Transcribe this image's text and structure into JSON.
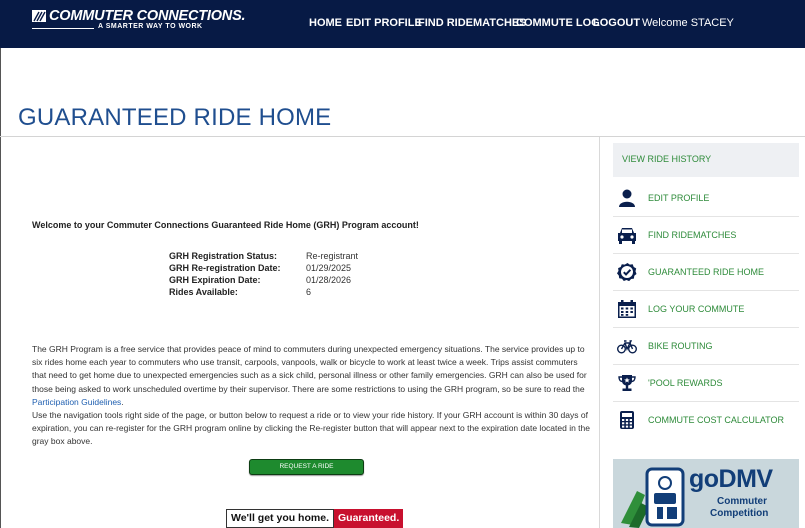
{
  "header": {
    "logo_title": "COMMUTER CONNECTIONS.",
    "logo_tagline": "A SMARTER WAY TO WORK",
    "nav": [
      "HOME",
      "EDIT PROFILE",
      "FIND RIDEMATCHES",
      "COMMUTE LOG",
      "LOGOUT"
    ],
    "welcome": "Welcome STACEY"
  },
  "page": {
    "title": "GUARANTEED RIDE HOME"
  },
  "main": {
    "welcome_line": "Welcome to your Commuter Connections Guaranteed Ride Home (GRH) Program account!",
    "status": [
      {
        "label": "GRH Registration Status:",
        "value": "Re-registrant"
      },
      {
        "label": "GRH Re-registration Date:",
        "value": "01/29/2025"
      },
      {
        "label": "GRH Expiration Date:",
        "value": "01/28/2026"
      },
      {
        "label": "Rides Available:",
        "value": "6"
      }
    ],
    "description_1": "The GRH Program is a free service that provides peace of mind to commuters during unexpected emergency situations. The service provides up to six rides home each year to commuters who use transit, carpools, vanpools, walk or bicycle to work at least twice a week. Trips assist commuters that need to get home due to unexpected emergencies such as a sick child, personal illness or other family emergencies. GRH can also be used for those being asked to work unscheduled overtime by their supervisor. There are some restrictions to using the GRH program, so be sure to read the ",
    "guidelines_link": "Participation Guidelines",
    "description_1_end": ".",
    "description_2": "Use the navigation tools right side of the page, or button below to request a ride or to view your ride history. If your GRH account is within 30 days of expiration, you can re-register for the GRH program online by clicking the Re-register button that will appear next to the expiration date located in the gray box above.",
    "request_button": "REQUEST A RIDE",
    "banner_left": "We'll get you home.",
    "banner_right": "Guaranteed."
  },
  "sidebar": {
    "header_link": "VIEW RIDE HISTORY",
    "items": [
      {
        "label": "EDIT PROFILE",
        "icon": "person-icon"
      },
      {
        "label": "FIND RIDEMATCHES",
        "icon": "car-icon"
      },
      {
        "label": "GUARANTEED RIDE HOME",
        "icon": "check-badge-icon"
      },
      {
        "label": "LOG YOUR COMMUTE",
        "icon": "calendar-icon"
      },
      {
        "label": "BIKE ROUTING",
        "icon": "bicycle-icon"
      },
      {
        "label": "'POOL REWARDS",
        "icon": "trophy-icon"
      },
      {
        "label": "COMMUTE COST CALCULATOR",
        "icon": "calculator-icon"
      }
    ],
    "promo": {
      "title": "goDMV",
      "line1": "Commuter",
      "line2": "Competition"
    }
  },
  "colors": {
    "header_bg": "#071a45",
    "title_blue": "#1f4e8f",
    "link_green": "#2e8b3a",
    "button_green": "#1e8a2e",
    "banner_red": "#c8102e"
  }
}
